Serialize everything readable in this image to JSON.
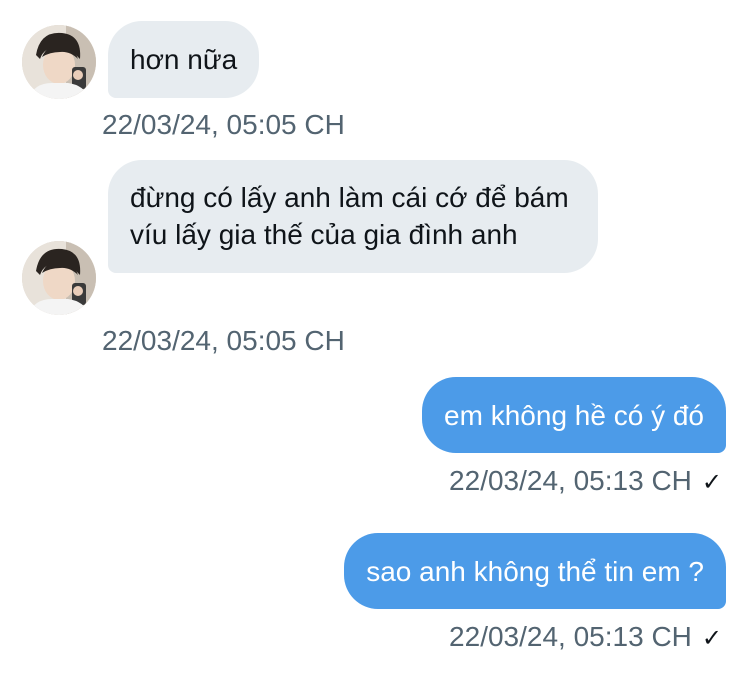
{
  "conversation": {
    "messages": [
      {
        "direction": "incoming",
        "text": "hơn nữa",
        "time": "22/03/24, 05:05 CH"
      },
      {
        "direction": "incoming",
        "text": "đừng có lấy anh làm cái cớ để bám víu lấy gia thế của gia đình anh",
        "time": "22/03/24, 05:05 CH"
      },
      {
        "direction": "outgoing",
        "text": "em không hề có ý đó",
        "time": "22/03/24, 05:13 CH",
        "status_icon": "checkmark-icon",
        "status_glyph": "✓"
      },
      {
        "direction": "outgoing",
        "text": "sao anh không thể tin em ?",
        "time": "22/03/24, 05:13 CH",
        "status_icon": "checkmark-icon",
        "status_glyph": "✓"
      }
    ]
  },
  "colors": {
    "incoming_bubble": "#e7ecf0",
    "outgoing_bubble": "#4c9be8",
    "timestamp": "#536471"
  }
}
